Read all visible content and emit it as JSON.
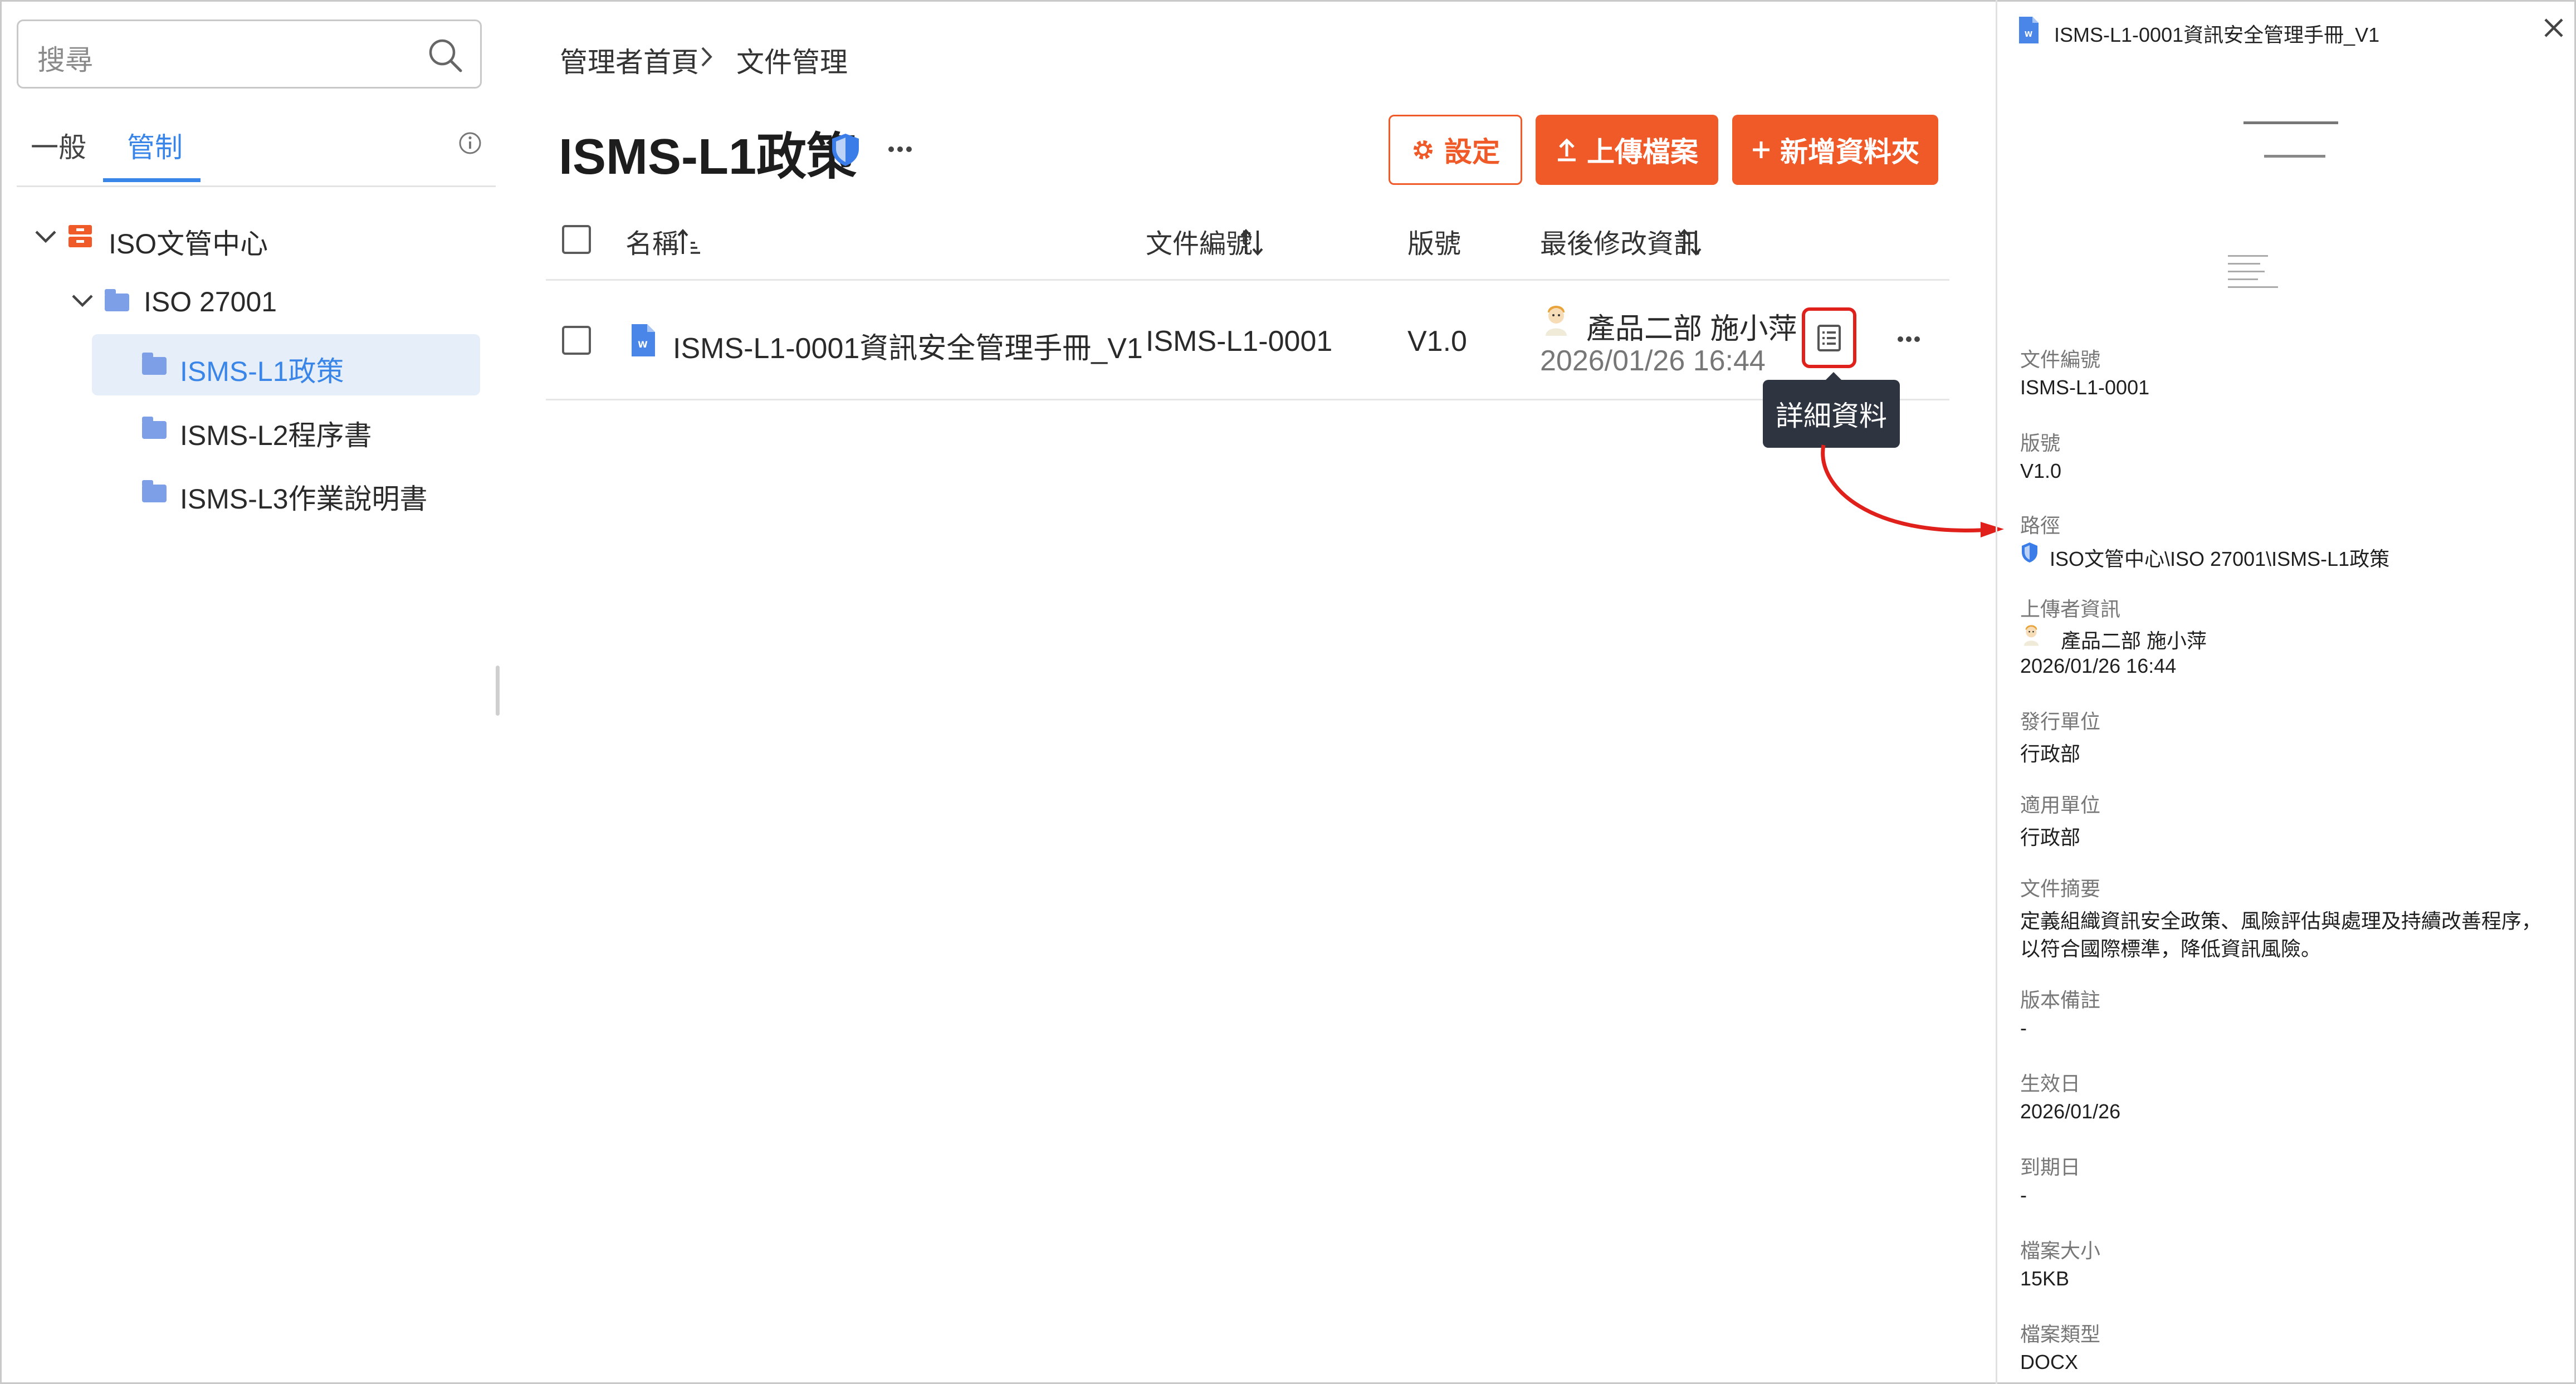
{
  "sidebar": {
    "search_placeholder": "搜尋",
    "tabs": {
      "general": "一般",
      "control": "管制"
    },
    "tree": {
      "root": "ISO文管中心",
      "child": "ISO 27001",
      "items": [
        "ISMS-L1政策",
        "ISMS-L2程序書",
        "ISMS-L3作業說明書"
      ]
    }
  },
  "main": {
    "breadcrumb": {
      "home": "管理者首頁",
      "current": "文件管理"
    },
    "title": "ISMS-L1政策",
    "buttons": {
      "settings": "設定",
      "upload": "上傳檔案",
      "new_folder": "新增資料夾"
    },
    "columns": {
      "name": "名稱",
      "doc_no": "文件編號",
      "version": "版號",
      "last_modified": "最後修改資訊"
    },
    "row": {
      "name": "ISMS-L1-0001資訊安全管理手冊_V1",
      "doc_no": "ISMS-L1-0001",
      "version": "V1.0",
      "modifier": "產品二部 施小萍",
      "modified_at": "2026/01/26 16:44"
    },
    "tooltip": "詳細資料"
  },
  "panel": {
    "title": "ISMS-L1-0001資訊安全管理手冊_V1",
    "fields": [
      {
        "label": "文件編號",
        "value": "ISMS-L1-0001"
      },
      {
        "label": "版號",
        "value": "V1.0"
      },
      {
        "label": "路徑",
        "value": "ISO文管中心\\ISO 27001\\ISMS-L1政策"
      },
      {
        "label": "上傳者資訊",
        "value": "產品二部 施小萍",
        "value2": "2026/01/26 16:44"
      },
      {
        "label": "發行單位",
        "value": "行政部"
      },
      {
        "label": "適用單位",
        "value": "行政部"
      },
      {
        "label": "文件摘要",
        "value": "定義組織資訊安全政策、風險評估與處理及持續改善程序，",
        "value2": "以符合國際標準，降低資訊風險。"
      },
      {
        "label": "版本備註",
        "value": "-"
      },
      {
        "label": "生效日",
        "value": "2026/01/26"
      },
      {
        "label": "到期日",
        "value": "-"
      },
      {
        "label": "檔案大小",
        "value": "15KB"
      },
      {
        "label": "檔案類型",
        "value": "DOCX"
      }
    ]
  },
  "colors": {
    "accent": "#f05a28",
    "link_blue": "#3a86e8",
    "selected_bg": "#e6eefa",
    "highlight_red": "#e0201b"
  },
  "icons": [
    "search-icon",
    "info-icon",
    "chevron-down-icon",
    "iso-center-icon",
    "folder-icon",
    "shield-icon",
    "more-icon",
    "gear-icon",
    "upload-icon",
    "plus-icon",
    "sort-asc-icon",
    "sort-icon",
    "word-doc-icon",
    "avatar-icon",
    "details-icon",
    "close-icon",
    "arrow-annotation"
  ]
}
